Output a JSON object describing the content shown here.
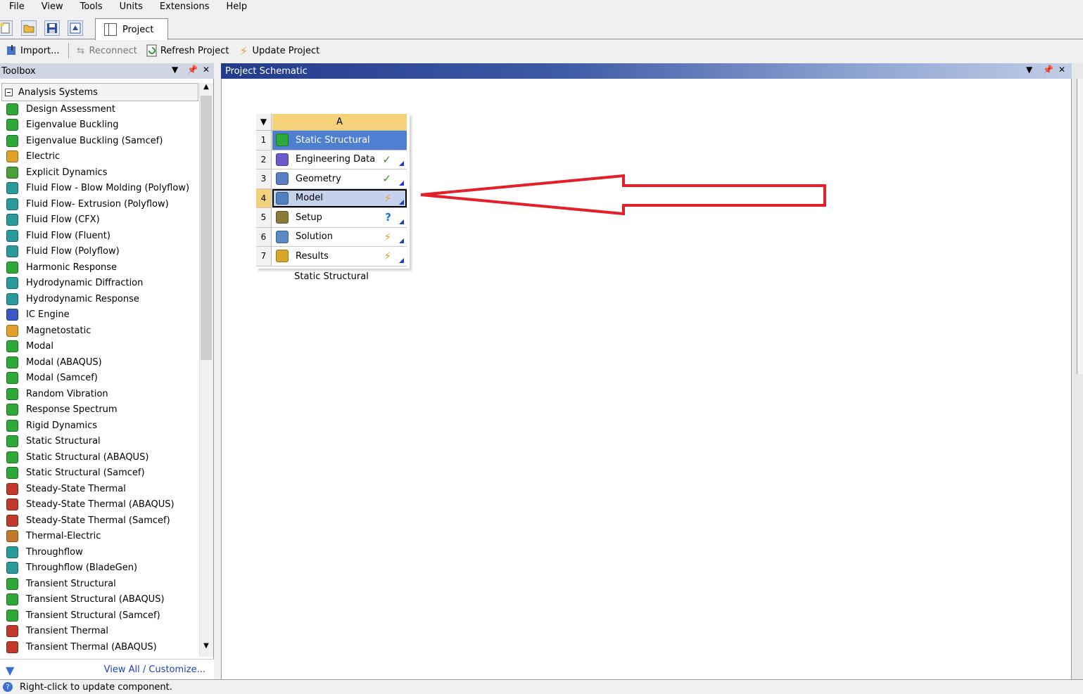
{
  "menu": [
    "File",
    "View",
    "Tools",
    "Units",
    "Extensions",
    "Help"
  ],
  "tabs": {
    "project": "Project"
  },
  "toolbar": {
    "import": "Import...",
    "reconnect": "Reconnect",
    "refresh": "Refresh Project",
    "update": "Update Project"
  },
  "toolbox": {
    "title": "Toolbox",
    "group": "Analysis Systems",
    "items": [
      {
        "label": "Design Assessment",
        "color": "#2fa83a"
      },
      {
        "label": "Eigenvalue Buckling",
        "color": "#2fa83a"
      },
      {
        "label": "Eigenvalue Buckling (Samcef)",
        "color": "#2fa83a"
      },
      {
        "label": "Electric",
        "color": "#e0a12a"
      },
      {
        "label": "Explicit Dynamics",
        "color": "#4a9e3b"
      },
      {
        "label": "Fluid Flow - Blow Molding (Polyflow)",
        "color": "#2a9a9a"
      },
      {
        "label": "Fluid Flow- Extrusion (Polyflow)",
        "color": "#2a9a9a"
      },
      {
        "label": "Fluid Flow (CFX)",
        "color": "#2a9a9a"
      },
      {
        "label": "Fluid Flow (Fluent)",
        "color": "#2a9a9a"
      },
      {
        "label": "Fluid Flow (Polyflow)",
        "color": "#2a9a9a"
      },
      {
        "label": "Harmonic Response",
        "color": "#2fa83a"
      },
      {
        "label": "Hydrodynamic Diffraction",
        "color": "#2a9a9a"
      },
      {
        "label": "Hydrodynamic Response",
        "color": "#2a9a9a"
      },
      {
        "label": "IC Engine",
        "color": "#3b58c4"
      },
      {
        "label": "Magnetostatic",
        "color": "#e0a12a"
      },
      {
        "label": "Modal",
        "color": "#2fa83a"
      },
      {
        "label": "Modal (ABAQUS)",
        "color": "#2fa83a"
      },
      {
        "label": "Modal (Samcef)",
        "color": "#2fa83a"
      },
      {
        "label": "Random Vibration",
        "color": "#2fa83a"
      },
      {
        "label": "Response Spectrum",
        "color": "#2fa83a"
      },
      {
        "label": "Rigid Dynamics",
        "color": "#2fa83a"
      },
      {
        "label": "Static Structural",
        "color": "#2fa83a"
      },
      {
        "label": "Static Structural (ABAQUS)",
        "color": "#2fa83a"
      },
      {
        "label": "Static Structural (Samcef)",
        "color": "#2fa83a"
      },
      {
        "label": "Steady-State Thermal",
        "color": "#c0392b"
      },
      {
        "label": "Steady-State Thermal (ABAQUS)",
        "color": "#c0392b"
      },
      {
        "label": "Steady-State Thermal (Samcef)",
        "color": "#c0392b"
      },
      {
        "label": "Thermal-Electric",
        "color": "#c07a2b"
      },
      {
        "label": "Throughflow",
        "color": "#2a9a9a"
      },
      {
        "label": "Throughflow (BladeGen)",
        "color": "#2a9a9a"
      },
      {
        "label": "Transient Structural",
        "color": "#2fa83a"
      },
      {
        "label": "Transient Structural (ABAQUS)",
        "color": "#2fa83a"
      },
      {
        "label": "Transient Structural (Samcef)",
        "color": "#2fa83a"
      },
      {
        "label": "Transient Thermal",
        "color": "#c0392b"
      },
      {
        "label": "Transient Thermal (ABAQUS)",
        "color": "#c0392b"
      }
    ],
    "view_all": "View All / Customize..."
  },
  "schematic": {
    "title": "Project Schematic",
    "column": "A",
    "caption": "Static Structural",
    "rows": [
      {
        "num": "1",
        "label": "Static Structural",
        "status": "",
        "icon_color": "#2fa83a"
      },
      {
        "num": "2",
        "label": "Engineering Data",
        "status": "✓",
        "status_color": "#3a8a2a",
        "icon_color": "#6a5acd"
      },
      {
        "num": "3",
        "label": "Geometry",
        "status": "✓",
        "status_color": "#3a8a2a",
        "icon_color": "#5b7fc4"
      },
      {
        "num": "4",
        "label": "Model",
        "status": "⚡",
        "status_color": "#e0a12a",
        "icon_color": "#4f7fbf"
      },
      {
        "num": "5",
        "label": "Setup",
        "status": "?",
        "status_color": "#1c6fd6",
        "icon_color": "#8a7a3a"
      },
      {
        "num": "6",
        "label": "Solution",
        "status": "⚡",
        "status_color": "#e0a12a",
        "icon_color": "#5a8ac4"
      },
      {
        "num": "7",
        "label": "Results",
        "status": "⚡",
        "status_color": "#e0a12a",
        "icon_color": "#d6a62a"
      }
    ]
  },
  "status": "Right-click to update component."
}
